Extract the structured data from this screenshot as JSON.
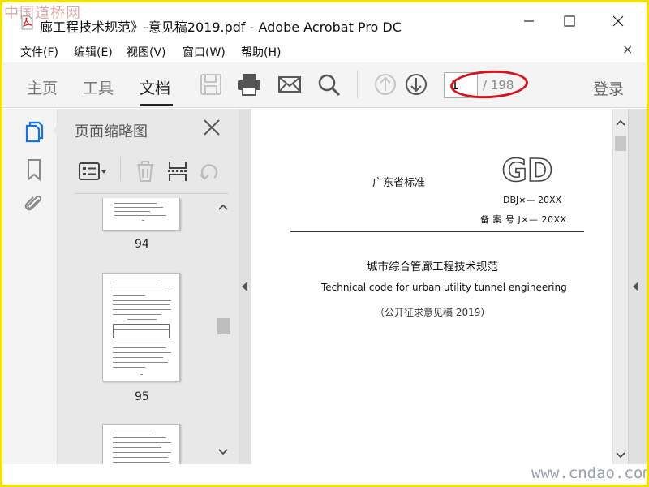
{
  "window": {
    "title": "廊工程技术规范》-意见稿2019.pdf - Adobe Acrobat Pro DC",
    "watermark_top": "中国道桥网",
    "watermark_bottom": "www.cndao.com",
    "minimize_glyph": "—",
    "maximize_glyph": "☐",
    "close_glyph": "✕"
  },
  "menu": {
    "items": [
      "文件(F)",
      "编辑(E)",
      "视图(V)",
      "窗口(W)",
      "帮助(H)"
    ],
    "close_glyph": "×"
  },
  "toolbar": {
    "tabs": [
      "主页",
      "工具",
      "文档"
    ],
    "active_tab": "文档",
    "page_current": "1",
    "page_total": "/ 198",
    "login_label": "登录",
    "icons": [
      "save-icon",
      "print-icon",
      "email-icon",
      "search-icon",
      "page-up-icon",
      "page-down-icon"
    ]
  },
  "nav_rail": {
    "icons": [
      "page-thumbnails-icon",
      "bookmark-icon",
      "attachment-icon"
    ]
  },
  "thumbnail_panel": {
    "title": "页面缩略图",
    "tools": [
      "options-menu-icon",
      "delete-icon",
      "extract-icon",
      "rotate-icon"
    ],
    "pages": [
      {
        "label": "94"
      },
      {
        "label": "95"
      },
      {
        "label": ""
      }
    ]
  },
  "document": {
    "std_label": "广东省标准",
    "logo_text": "GD",
    "std_code": "DBJ×— 20XX",
    "record_no": "备 案 号 J×— 20XX",
    "title_cn": "城市综合管廊工程技术规范",
    "title_en": "Technical code for urban utility tunnel engineering",
    "draft_note": "（公开征求意见稿 2019）"
  },
  "colors": {
    "frame_border": "#f2e200",
    "annotation_red": "#d8141a",
    "acrobat_red": "#d12a25",
    "nav_active_blue": "#1473e6"
  }
}
